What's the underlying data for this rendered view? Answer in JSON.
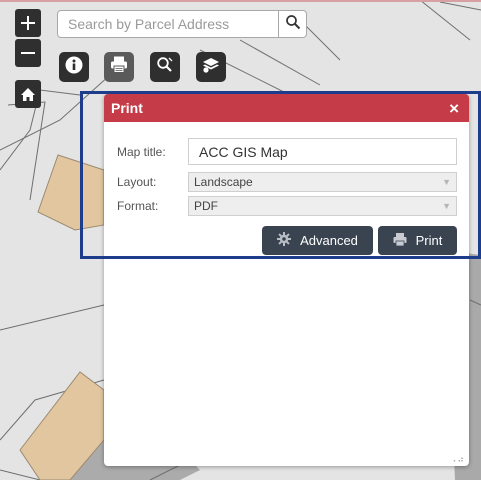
{
  "map": {
    "colors": {
      "background": "#e4e4e4",
      "parcel": "#e2c6a0",
      "parcel_edge": "#9c8a70",
      "road": "#ababab",
      "lines": "#6f6f6f"
    }
  },
  "zoom_controls": {
    "zoom_in": "plus-icon",
    "zoom_out": "minus-icon",
    "home": "home-icon"
  },
  "search": {
    "placeholder": "Search by Parcel Address",
    "value": "",
    "button_icon": "search-icon"
  },
  "toolbar": {
    "tools": [
      "info-icon",
      "printer-icon",
      "zoom-search-icon",
      "layers-icon"
    ],
    "active_tool": "printer-icon"
  },
  "print_panel": {
    "title": "Print",
    "close_label": "×",
    "header_color": "#c53b47",
    "map_title_label": "Map title:",
    "map_title_value": "ACC GIS Map",
    "layout_label": "Layout:",
    "layout_value": "Landscape",
    "format_label": "Format:",
    "format_value": "PDF",
    "advanced_label": "Advanced",
    "print_label": "Print",
    "button_color": "#3a4451"
  },
  "highlight": {
    "color": "#1d3c8c"
  }
}
